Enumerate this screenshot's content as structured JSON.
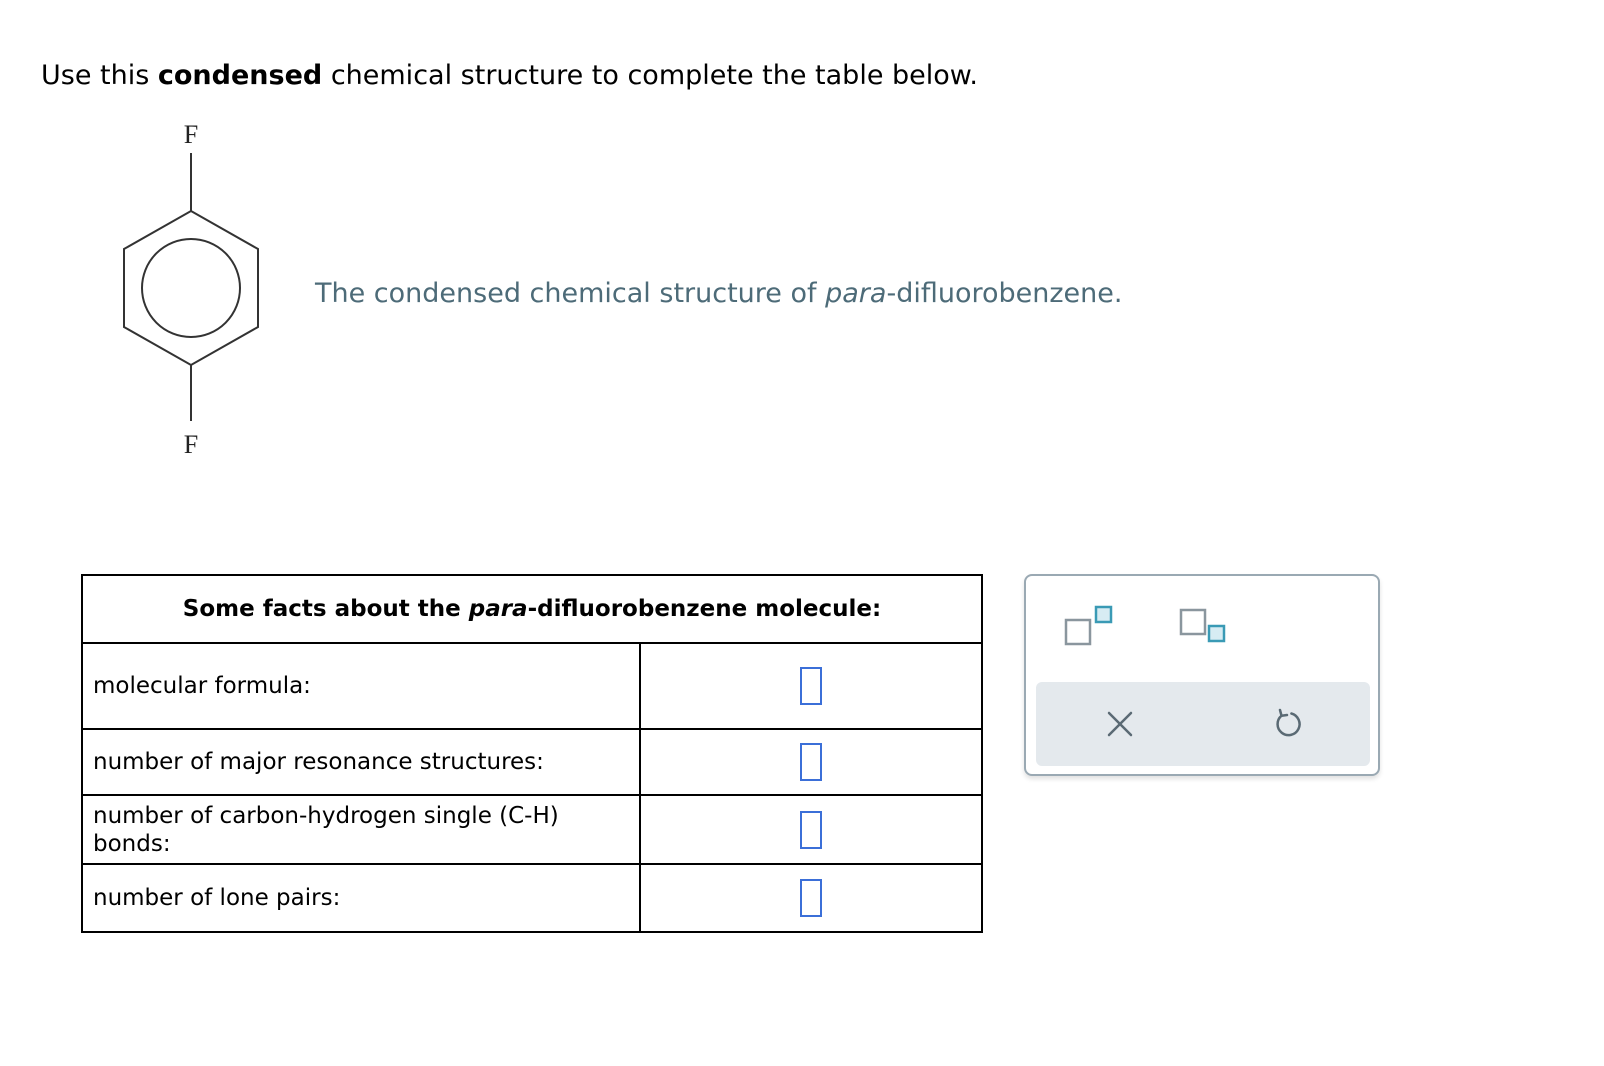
{
  "instruction": {
    "prefix": "Use this ",
    "bold": "condensed",
    "suffix": " chemical structure to complete the table below."
  },
  "structure": {
    "top_atom": "F",
    "bottom_atom": "F"
  },
  "caption": {
    "prefix": "The condensed chemical structure of ",
    "italic": "para",
    "suffix": "-difluorobenzene."
  },
  "table": {
    "header": {
      "prefix": "Some facts about the ",
      "italic": "para",
      "suffix": "-difluorobenzene molecule:"
    },
    "rows": [
      {
        "label": "molecular formula:",
        "value": ""
      },
      {
        "label": "number of major resonance structures:",
        "value": ""
      },
      {
        "label": "number of carbon-hydrogen single (C-H) bonds:",
        "value": ""
      },
      {
        "label": "number of lone pairs:",
        "value": ""
      }
    ]
  },
  "tools": {
    "superscript": "superscript-icon",
    "subscript": "subscript-icon",
    "clear": "close-icon",
    "undo": "undo-icon"
  },
  "colors": {
    "caption": "#4d6b78",
    "answer_border": "#3b6fd8",
    "tool_accent": "#3a9ab5",
    "panel_bg": "#e4e9ed"
  }
}
